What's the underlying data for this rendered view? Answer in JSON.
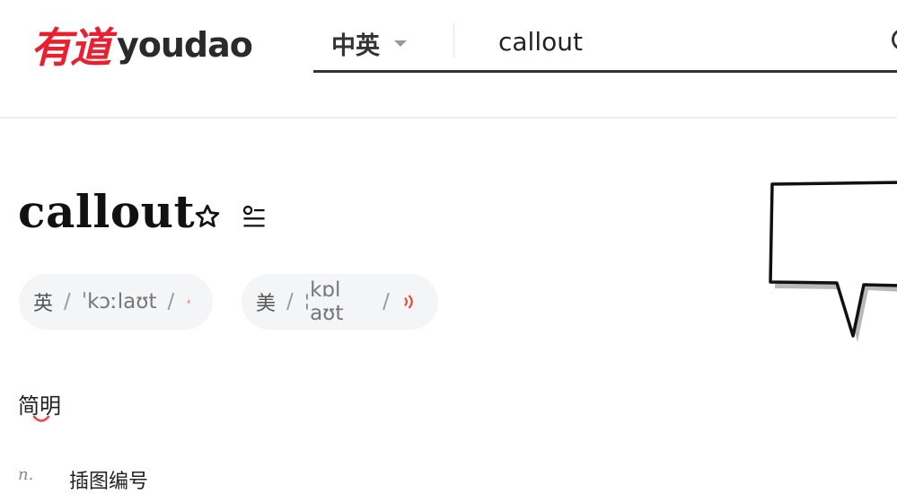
{
  "header": {
    "logo_cn": "有道",
    "logo_en": "youdao",
    "lang": "中英",
    "query": "callout"
  },
  "entry": {
    "word": "callout",
    "phonetics": [
      {
        "label": "英",
        "ipa": "ˈkɔːlaʊt"
      },
      {
        "label": "美",
        "ipa": "ˌkɒlˈaʊt"
      }
    ],
    "slash": "/",
    "tab": "简明",
    "definition": {
      "pos": "n.",
      "text": "插图编号"
    }
  },
  "colors": {
    "brand_red": "#e8202f",
    "accent_red": "#e84a3c",
    "chip_bg": "#f4f5f7"
  },
  "icons": [
    "search-icon",
    "star-icon",
    "list-icon",
    "speaker-icon",
    "callout-bubble-image"
  ]
}
